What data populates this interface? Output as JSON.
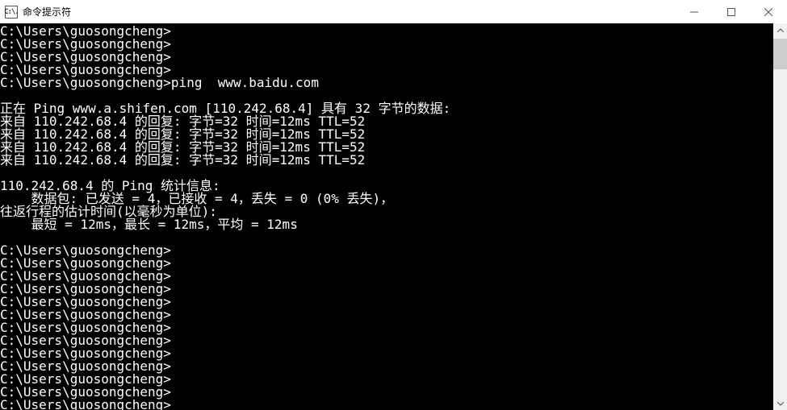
{
  "window": {
    "title": "命令提示符",
    "icon_text": "C:\\."
  },
  "terminal": {
    "prompt_path": "C:\\Users\\guosongcheng>",
    "command": "ping  www.baidu.com",
    "lines": [
      "C:\\Users\\guosongcheng>",
      "C:\\Users\\guosongcheng>",
      "C:\\Users\\guosongcheng>",
      "C:\\Users\\guosongcheng>",
      "C:\\Users\\guosongcheng>ping  www.baidu.com",
      "",
      "正在 Ping www.a.shifen.com [110.242.68.4] 具有 32 字节的数据:",
      "来自 110.242.68.4 的回复: 字节=32 时间=12ms TTL=52",
      "来自 110.242.68.4 的回复: 字节=32 时间=12ms TTL=52",
      "来自 110.242.68.4 的回复: 字节=32 时间=12ms TTL=52",
      "来自 110.242.68.4 的回复: 字节=32 时间=12ms TTL=52",
      "",
      "110.242.68.4 的 Ping 统计信息:",
      "    数据包: 已发送 = 4，已接收 = 4，丢失 = 0 (0% 丢失)，",
      "往返行程的估计时间(以毫秒为单位):",
      "    最短 = 12ms，最长 = 12ms，平均 = 12ms",
      "",
      "C:\\Users\\guosongcheng>",
      "C:\\Users\\guosongcheng>",
      "C:\\Users\\guosongcheng>",
      "C:\\Users\\guosongcheng>",
      "C:\\Users\\guosongcheng>",
      "C:\\Users\\guosongcheng>",
      "C:\\Users\\guosongcheng>",
      "C:\\Users\\guosongcheng>",
      "C:\\Users\\guosongcheng>",
      "C:\\Users\\guosongcheng>",
      "C:\\Users\\guosongcheng>",
      "C:\\Users\\guosongcheng>",
      "C:\\Users\\guosongcheng>"
    ]
  },
  "ping_output": {
    "target_hostname": "www.baidu.com",
    "resolved_hostname": "www.a.shifen.com",
    "resolved_ip": "110.242.68.4",
    "bytes": 32,
    "replies": [
      {
        "from": "110.242.68.4",
        "bytes": 32,
        "time_ms": 12,
        "ttl": 52
      },
      {
        "from": "110.242.68.4",
        "bytes": 32,
        "time_ms": 12,
        "ttl": 52
      },
      {
        "from": "110.242.68.4",
        "bytes": 32,
        "time_ms": 12,
        "ttl": 52
      },
      {
        "from": "110.242.68.4",
        "bytes": 32,
        "time_ms": 12,
        "ttl": 52
      }
    ],
    "stats": {
      "sent": 4,
      "received": 4,
      "lost": 0,
      "loss_percent": 0,
      "min_ms": 12,
      "max_ms": 12,
      "avg_ms": 12
    }
  }
}
